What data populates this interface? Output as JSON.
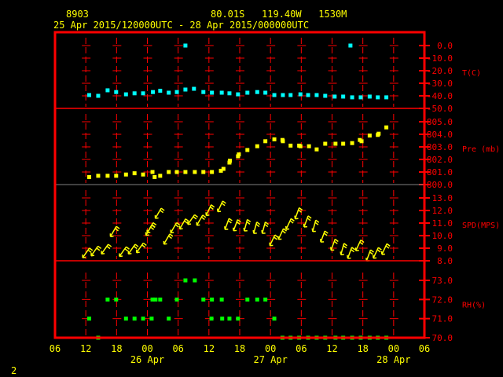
{
  "header": {
    "station": "8903",
    "location": "80.01S   119.40W   1530M",
    "period": "25 Apr 2015/120000UTC - 28 Apr 2015/000000UTC"
  },
  "page_number": "2",
  "colors": {
    "frame": "#ff0000",
    "text": "#ffff00",
    "temperature": "#00ffff",
    "pressure": "#ffff00",
    "wind": "#ffff00",
    "rh": "#00ff00",
    "divider_gray": "#808080"
  },
  "chart_data": [
    {
      "type": "scatter",
      "ylabel": "T(C)",
      "ylim": [
        -50,
        0
      ],
      "yticks": [
        "0.0",
        "-10.0",
        "-20.0",
        "-30.0",
        "-40.0",
        "-50.0"
      ],
      "ytick_values": [
        0,
        -10,
        -20,
        -30,
        -40,
        -50
      ],
      "points": [
        [
          "25 12:40",
          -39.4
        ],
        [
          "25 14:25",
          -40
        ],
        [
          "25 16:15",
          -35.6
        ],
        [
          "25 17:55",
          -37
        ],
        [
          "25 19:50",
          -38.8
        ],
        [
          "25 21:30",
          -38
        ],
        [
          "25 23:10",
          -38
        ],
        [
          "26 01:05",
          -37
        ],
        [
          "26 02:30",
          -36
        ],
        [
          "26 04:10",
          -37.5
        ],
        [
          "26 05:45",
          -37
        ],
        [
          "26 07:25",
          0
        ],
        [
          "26 07:25",
          -35
        ],
        [
          "26 09:05",
          -34.4
        ],
        [
          "26 10:55",
          -37
        ],
        [
          "26 12:35",
          -37.5
        ],
        [
          "26 14:30",
          -37.5
        ],
        [
          "26 16:00",
          -38
        ],
        [
          "26 17:40",
          -38.8
        ],
        [
          "26 19:30",
          -37.5
        ],
        [
          "26 21:25",
          -37
        ],
        [
          "26 23:00",
          -37.5
        ],
        [
          "27 00:45",
          -39.4
        ],
        [
          "27 02:25",
          -39.4
        ],
        [
          "27 03:55",
          -39.4
        ],
        [
          "27 05:50",
          -38.8
        ],
        [
          "27 07:20",
          -39.4
        ],
        [
          "27 09:00",
          -39.4
        ],
        [
          "27 10:40",
          -40
        ],
        [
          "27 12:30",
          -40.6
        ],
        [
          "27 14:10",
          -40.6
        ],
        [
          "27 15:35",
          0
        ],
        [
          "27 15:55",
          -41.2
        ],
        [
          "27 17:35",
          -41.2
        ],
        [
          "27 19:20",
          -40.6
        ],
        [
          "27 20:55",
          -41.2
        ],
        [
          "27 22:35",
          -41.2
        ]
      ]
    },
    {
      "type": "scatter",
      "ylabel": "Pre (mb)",
      "ylim": [
        800,
        805
      ],
      "yticks": [
        "805.0",
        "804.0",
        "803.0",
        "802.0",
        "801.0",
        "800.0"
      ],
      "ytick_values": [
        805,
        804,
        803,
        802,
        801,
        800
      ],
      "points": [
        [
          "25 12:40",
          800.6
        ],
        [
          "25 14:25",
          800.7
        ],
        [
          "25 16:15",
          800.7
        ],
        [
          "25 17:55",
          800.7
        ],
        [
          "25 19:50",
          800.8
        ],
        [
          "25 21:30",
          800.9
        ],
        [
          "25 23:10",
          800.8
        ],
        [
          "26 01:00",
          801.0
        ],
        [
          "26 01:25",
          800.6
        ],
        [
          "26 02:30",
          800.7
        ],
        [
          "26 04:10",
          801.0
        ],
        [
          "26 05:45",
          801.0
        ],
        [
          "26 07:25",
          801.0
        ],
        [
          "26 09:15",
          801.0
        ],
        [
          "26 10:55",
          801.0
        ],
        [
          "26 12:35",
          801.0
        ],
        [
          "26 14:20",
          801.1
        ],
        [
          "26 14:50",
          801.25
        ],
        [
          "26 16:00",
          801.75
        ],
        [
          "26 16:05",
          801.9
        ],
        [
          "26 17:40",
          802.25
        ],
        [
          "26 17:50",
          802.4
        ],
        [
          "26 19:30",
          802.75
        ],
        [
          "26 21:25",
          803.05
        ],
        [
          "26 23:00",
          803.45
        ],
        [
          "27 00:45",
          803.6
        ],
        [
          "27 02:20",
          803.55
        ],
        [
          "27 02:25",
          803.45
        ],
        [
          "27 03:55",
          803.1
        ],
        [
          "27 05:35",
          803.1
        ],
        [
          "27 05:50",
          803.05
        ],
        [
          "27 07:30",
          803.05
        ],
        [
          "27 09:00",
          802.8
        ],
        [
          "27 10:40",
          803.25
        ],
        [
          "27 12:40",
          803.25
        ],
        [
          "27 14:10",
          803.25
        ],
        [
          "27 15:55",
          803.3
        ],
        [
          "27 17:25",
          803.55
        ],
        [
          "27 17:45",
          803.45
        ],
        [
          "27 19:20",
          803.9
        ],
        [
          "27 20:55",
          803.95
        ],
        [
          "27 21:05",
          804.05
        ],
        [
          "27 22:35",
          804.55
        ]
      ]
    },
    {
      "type": "wind-barb",
      "ylabel": "SPD(MPS)",
      "ylim": [
        8,
        13
      ],
      "yticks": [
        "13.0",
        "12.0",
        "11.0",
        "10.0",
        "9.0",
        "8.0"
      ],
      "ytick_values": [
        13,
        12,
        11,
        10,
        9,
        8
      ],
      "points": [
        [
          "25 12:00",
          8.6,
          35
        ],
        [
          "25 13:40",
          8.75,
          35
        ],
        [
          "25 15:40",
          8.9,
          35
        ],
        [
          "25 17:20",
          10.3,
          30
        ],
        [
          "25 19:10",
          8.7,
          35
        ],
        [
          "25 20:55",
          8.9,
          35
        ],
        [
          "25 22:30",
          9.0,
          35
        ],
        [
          "26 00:15",
          10.4,
          30
        ],
        [
          "26 00:30",
          10.6,
          30
        ],
        [
          "26 02:05",
          11.75,
          30
        ],
        [
          "26 03:45",
          9.7,
          30
        ],
        [
          "26 05:05",
          10.6,
          30
        ],
        [
          "26 06:50",
          10.9,
          30
        ],
        [
          "26 08:30",
          11.25,
          35
        ],
        [
          "26 10:10",
          11.2,
          30
        ],
        [
          "26 11:55",
          12.0,
          25
        ],
        [
          "26 14:10",
          12.3,
          25
        ],
        [
          "26 15:30",
          10.9,
          20
        ],
        [
          "26 17:10",
          10.8,
          20
        ],
        [
          "26 19:10",
          10.8,
          15
        ],
        [
          "26 21:00",
          10.6,
          15
        ],
        [
          "26 22:40",
          10.6,
          15
        ],
        [
          "27 00:20",
          9.6,
          25
        ],
        [
          "27 02:00",
          10.1,
          25
        ],
        [
          "27 03:30",
          10.9,
          25
        ],
        [
          "27 05:10",
          11.75,
          20
        ],
        [
          "27 06:55",
          11.1,
          20
        ],
        [
          "27 08:30",
          10.75,
          15
        ],
        [
          "27 10:10",
          9.9,
          20
        ],
        [
          "27 12:10",
          9.25,
          20
        ],
        [
          "27 14:00",
          8.9,
          15
        ],
        [
          "27 15:25",
          8.6,
          20
        ],
        [
          "27 17:05",
          9.2,
          25
        ],
        [
          "27 19:05",
          8.4,
          20
        ],
        [
          "27 20:30",
          8.6,
          25
        ],
        [
          "27 22:10",
          8.9,
          25
        ]
      ]
    },
    {
      "type": "scatter",
      "ylabel": "RH(%)",
      "ylim": [
        70,
        73
      ],
      "yticks": [
        "73.0",
        "72.0",
        "71.0",
        "70.0"
      ],
      "ytick_values": [
        73,
        72,
        71,
        70
      ],
      "points": [
        [
          "26 07:25",
          73
        ],
        [
          "26 09:15",
          73
        ],
        [
          "25 16:15",
          72
        ],
        [
          "25 17:55",
          72
        ],
        [
          "26 01:00",
          72
        ],
        [
          "26 01:35",
          72
        ],
        [
          "26 02:30",
          72
        ],
        [
          "26 05:45",
          72
        ],
        [
          "26 10:55",
          72
        ],
        [
          "26 12:35",
          72
        ],
        [
          "26 14:30",
          72
        ],
        [
          "26 19:30",
          72
        ],
        [
          "26 21:25",
          72
        ],
        [
          "26 23:00",
          72
        ],
        [
          "25 12:40",
          71
        ],
        [
          "25 19:50",
          71
        ],
        [
          "25 21:30",
          71
        ],
        [
          "25 23:10",
          71
        ],
        [
          "26 00:50",
          71
        ],
        [
          "26 04:10",
          71
        ],
        [
          "26 12:30",
          71
        ],
        [
          "26 14:35",
          71
        ],
        [
          "26 16:00",
          71
        ],
        [
          "26 17:40",
          71
        ],
        [
          "27 00:45",
          71
        ],
        [
          "25 14:25",
          70
        ],
        [
          "27 02:20",
          70
        ],
        [
          "27 03:55",
          70
        ],
        [
          "27 05:35",
          70
        ],
        [
          "27 07:20",
          70
        ],
        [
          "27 09:00",
          70
        ],
        [
          "27 10:40",
          70
        ],
        [
          "27 12:40",
          70
        ],
        [
          "27 14:10",
          70
        ],
        [
          "27 15:55",
          70
        ],
        [
          "27 17:35",
          70
        ],
        [
          "27 19:20",
          70
        ],
        [
          "27 20:55",
          70
        ],
        [
          "27 22:35",
          70
        ]
      ]
    }
  ],
  "x_axis": {
    "range": [
      "25 06:00",
      "28 06:00"
    ],
    "tick_labels": [
      "06",
      "12",
      "18",
      "00",
      "06",
      "12",
      "18",
      "00",
      "06",
      "12",
      "18",
      "00",
      "06"
    ],
    "date_labels": [
      {
        "label": "26 Apr",
        "at": "26 00:00"
      },
      {
        "label": "27 Apr",
        "at": "27 00:00"
      },
      {
        "label": "28 Apr",
        "at": "28 00:00"
      }
    ]
  }
}
